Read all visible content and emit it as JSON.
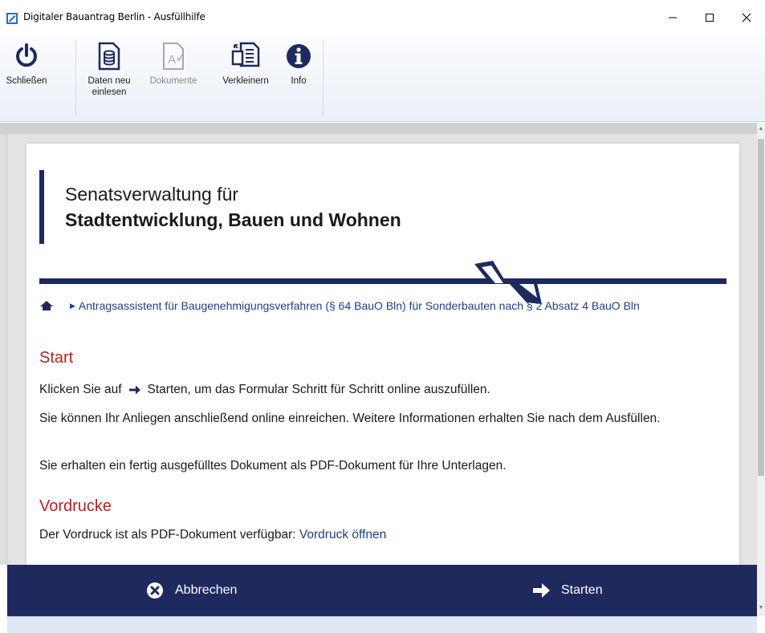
{
  "window": {
    "title": "Digitaler Bauantrag Berlin - Ausfüllhilfe",
    "minimize": "—",
    "maximize": "☐",
    "close": "✕"
  },
  "ribbon": {
    "buttons": [
      {
        "label": "Schließen",
        "icon": "power-icon",
        "enabled": true
      },
      {
        "label": "Daten neu einlesen",
        "icon": "database-document-icon",
        "enabled": true
      },
      {
        "label": "Dokumente",
        "icon": "document-text-icon",
        "enabled": false
      },
      {
        "label": "Verkleinern",
        "icon": "shrink-document-icon",
        "enabled": true
      },
      {
        "label": "Info",
        "icon": "info-icon",
        "enabled": true
      }
    ]
  },
  "org": {
    "line1": "Senatsverwaltung für",
    "line2": "Stadtentwicklung, Bauen und Wohnen"
  },
  "breadcrumb": {
    "home_icon": "home-icon",
    "item": "Antragsassistent für Baugenehmigungsverfahren (§ 64 BauO Bln) für Sonderbauten nach § 2 Absatz 4 BauO Bln"
  },
  "content": {
    "start_heading": "Start",
    "p1_before": "Klicken Sie auf",
    "p1_after": "Starten, um das Formular Schritt für Schritt online auszufüllen.",
    "p2": "Sie können Ihr Anliegen anschließend online einreichen. Weitere Informationen erhalten Sie nach dem Ausfüllen.",
    "p3": "Sie erhalten ein fertig ausgefülltes Dokument als PDF-Dokument für Ihre Unterlagen.",
    "vordrucke_heading": "Vordrucke",
    "p4_before": "Der Vordruck ist als PDF-Dokument verfügbar:",
    "p4_link": "Vordruck öffnen"
  },
  "actions": {
    "cancel_label": "Abbrechen",
    "start_label": "Starten"
  },
  "colors": {
    "navy": "#1e2a5e",
    "heading_red": "#b22424",
    "link_blue": "#1e3f8a"
  }
}
